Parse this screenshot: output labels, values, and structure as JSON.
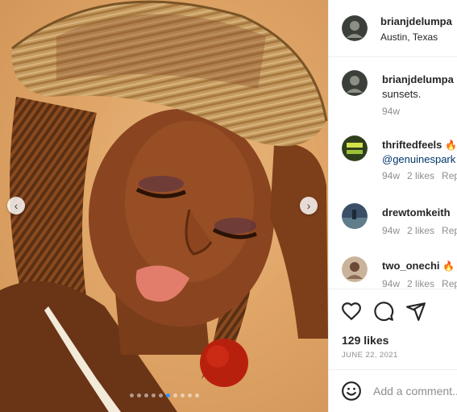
{
  "photo": {
    "prev_icon": "chevron-left-icon",
    "next_icon": "chevron-right-icon",
    "slide_count": 10,
    "active_slide": 6
  },
  "header": {
    "username": "brianjdelumpa",
    "location": "Austin, Texas",
    "avatar_color": "#3a3f3a"
  },
  "comments": [
    {
      "username": "brianjdelumpa",
      "text": "sunsets.",
      "time": "94w",
      "likes": "",
      "reply": "",
      "avatar_color": "#3a3f3a"
    },
    {
      "username": "thriftedfeels",
      "emoji": "🔥",
      "mention": "@genuinespark",
      "time": "94w",
      "likes": "2 likes",
      "reply": "Reply",
      "avatar_color": "#2f3f1c"
    },
    {
      "username": "drewtomkeith",
      "time": "94w",
      "likes": "2 likes",
      "reply": "Reply",
      "avatar_color": "#3b4f68"
    },
    {
      "username": "two_onechi",
      "emoji": "🔥",
      "time": "94w",
      "likes": "2 likes",
      "reply": "Reply",
      "avatar_color": "#8a6a56"
    }
  ],
  "actions": {
    "like_icon": "heart-icon",
    "comment_icon": "comment-bubble-icon",
    "share_icon": "paper-plane-icon"
  },
  "likes": "129 likes",
  "date": "JUNE 22, 2021",
  "add_comment": {
    "placeholder": "Add a comment...",
    "emoji_icon": "smiley-icon"
  }
}
